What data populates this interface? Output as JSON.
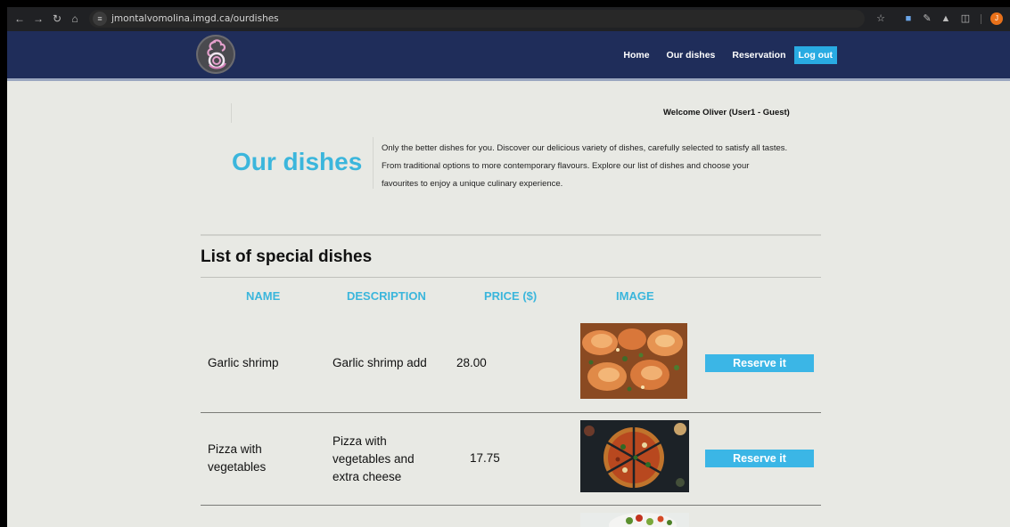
{
  "browser": {
    "url": "jmontalvomolina.imgd.ca/ourdishes",
    "profile_initial": "J"
  },
  "nav": {
    "home": "Home",
    "our_dishes": "Our dishes",
    "reservation": "Reservation",
    "logout": "Log out"
  },
  "welcome": "Welcome Oliver (User1 - Guest)",
  "hero": {
    "title": "Our dishes",
    "description_lines": [
      "Only the better dishes for you. Discover our delicious variety of dishes, carefully selected to satisfy all tastes.",
      "From traditional options to more contemporary flavours. Explore our list of dishes and choose your",
      "favourites to enjoy a unique culinary experience."
    ]
  },
  "list": {
    "title": "List of special dishes",
    "columns": [
      "NAME",
      "DESCRIPTION",
      "PRICE ($)",
      "IMAGE"
    ],
    "rows": [
      {
        "name_lines": [
          "Garlic shrimp"
        ],
        "description_lines": [
          "Garlic shrimp add"
        ],
        "price": "28.00",
        "image": "garlic-shrimp-photo",
        "button": "Reserve it"
      },
      {
        "name_lines": [
          "Pizza with",
          "vegetables"
        ],
        "description_lines": [
          "Pizza with",
          "vegetables and",
          "extra cheese"
        ],
        "price": "17.75",
        "image": "pizza-photo",
        "button": "Reserve it"
      },
      {
        "image": "salad-photo"
      }
    ]
  },
  "colors": {
    "header_bg": "#1f2d5a",
    "accent": "#3bb6dc",
    "button": "#3bb6e6",
    "page_bg": "#e8e9e4"
  }
}
